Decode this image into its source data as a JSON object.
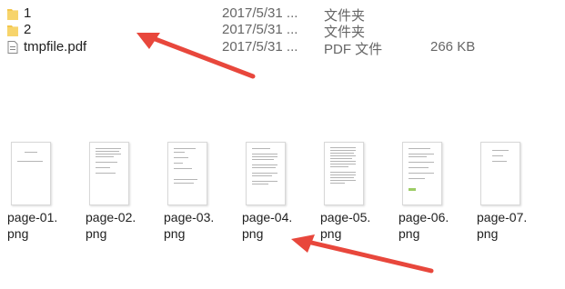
{
  "files": [
    {
      "name": "1",
      "date": "2017/5/31 ...",
      "type": "文件夹",
      "size": "",
      "icon": "folder-icon"
    },
    {
      "name": "2",
      "date": "2017/5/31 ...",
      "type": "文件夹",
      "size": "",
      "icon": "folder-icon"
    },
    {
      "name": "tmpfile.pdf",
      "date": "2017/5/31 ...",
      "type": "PDF 文件",
      "size": "266 KB",
      "icon": "pdf-file-icon"
    }
  ],
  "thumbnails": [
    {
      "label": "page-01.png"
    },
    {
      "label": "page-02.png"
    },
    {
      "label": "page-03.png"
    },
    {
      "label": "page-04.png"
    },
    {
      "label": "page-05.png"
    },
    {
      "label": "page-06.png"
    },
    {
      "label": "page-07.png"
    }
  ],
  "colors": {
    "arrow": "#e8473c",
    "folder": "#f3c64b"
  }
}
